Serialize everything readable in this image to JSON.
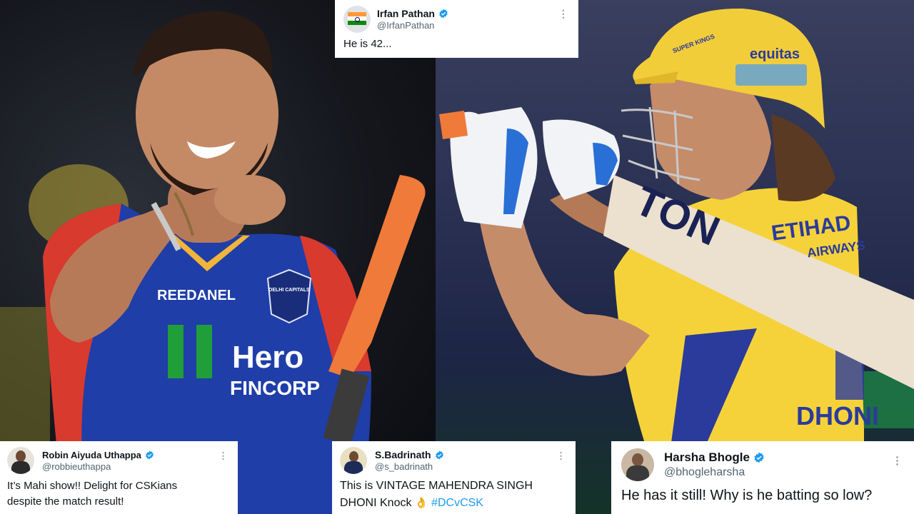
{
  "tweets": {
    "irfan": {
      "name": "Irfan Pathan",
      "handle": "@IrfanPathan",
      "text": "He is 42..."
    },
    "robin": {
      "name": "Robin Aiyuda Uthappa",
      "handle": "@robbieuthappa",
      "text_line1": "It’s Mahi show!! Delight for CSKians",
      "text_line2": "despite the match result!"
    },
    "badrinath": {
      "name": "S.Badrinath",
      "handle": "@s_badrinath",
      "text_line1": "This is VINTAGE MAHENDRA SINGH",
      "text_line2": "DHONI Knock",
      "emoji": "👌",
      "hashtag": "#DCvCSK"
    },
    "harsha": {
      "name": "Harsha Bhogle",
      "handle": "@bhogleharsha",
      "text": "He has it still! Why is he batting so low?"
    }
  },
  "photo_left": {
    "jersey_brand": "Hero",
    "jersey_sub": "FINCORP",
    "chest_text": "REEDANEL",
    "team_badge": "DELHI CAPITALS"
  },
  "photo_right": {
    "helmet_text": "equitas",
    "helmet_badge": "SUPER KINGS",
    "shirt_sponsor": "ETIHAD",
    "shirt_sponsor_sub": "AIRWAYS",
    "bat_text": "TON",
    "shirt_back": "DHONI"
  },
  "colors": {
    "verified": "#1d9bf0",
    "dc_blue": "#1f3ea8",
    "dc_red": "#d83a2e",
    "csk_yellow": "#f6d23a",
    "bat_grip": "#f07a3a"
  },
  "icons": [
    "verified-badge-icon",
    "more-options-icon"
  ]
}
